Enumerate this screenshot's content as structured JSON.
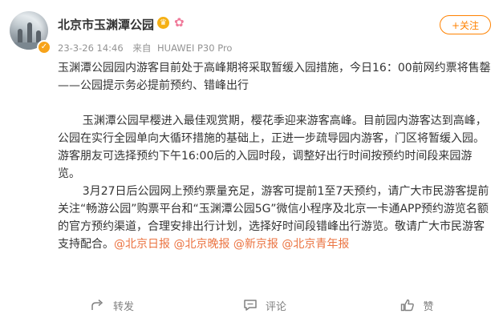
{
  "post": {
    "author": "北京市玉渊潭公园",
    "timestamp": "23-3-26 14:46",
    "source_prefix": "来自",
    "device": "HUAWEI P30 Pro",
    "follow_label": "+关注",
    "badges": [
      "crown-icon",
      "blossom-icon"
    ],
    "body": {
      "line1": "玉渊潭公园园内游客目前处于高峰期将采取暂缓入园措施，今日16：00前网约票将售罄",
      "line2": "——公园提示务必提前预约、错峰出行",
      "para1": "玉渊潭公园早樱进入最佳观赏期，樱花季迎来游客高峰。目前园内游客达到高峰，公园在实行全园单向大循环措施的基础上，正进一步疏导园内游客，门区将暂缓入园。游客朋友可选择预约下午16:00后的入园时段，调整好出行时间按预约时间段来园游览。",
      "para2": "3月27日后公园网上预约票量充足，游客可提前1至7天预约，请广大市民游客提前关注“畅游公园”购票平台和“玉渊潭公园5G”微信小程序及北京一卡通APP预约游览名额的官方预约渠道，合理安排出行计划，选择好时间段错峰出行游览。敬请广大市民游客支持配合。",
      "mentions": [
        "@北京日报",
        "@北京晚报",
        "@新京报",
        "@北京青年报"
      ]
    }
  },
  "actions": {
    "repost_label": "转发",
    "comment_label": "评论",
    "like_label": "赞"
  },
  "colors": {
    "accent": "#ff8200",
    "mention": "#eb7340",
    "meta": "#939393"
  }
}
